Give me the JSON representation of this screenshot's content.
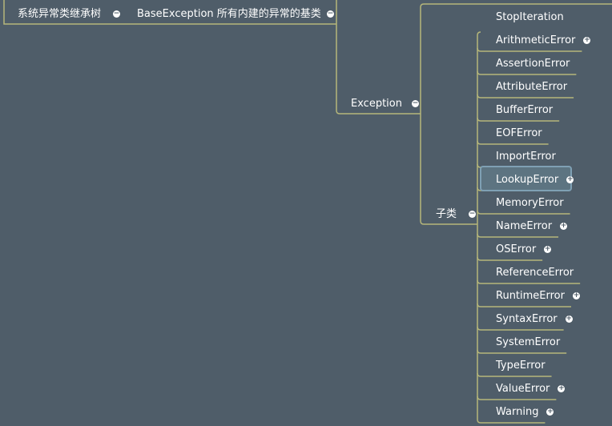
{
  "root": {
    "label": "系统异常类继承树"
  },
  "base": {
    "label": "BaseException 所有内建的异常的基类"
  },
  "exception": {
    "label": "Exception"
  },
  "subclass": {
    "label": "子类"
  },
  "stop_iteration": {
    "label": "StopIteration"
  },
  "selected": "LookupError",
  "children": [
    {
      "label": "ArithmeticError",
      "expandable": true
    },
    {
      "label": "AssertionError",
      "expandable": false
    },
    {
      "label": "AttributeError",
      "expandable": false
    },
    {
      "label": "BufferError",
      "expandable": false
    },
    {
      "label": "EOFError",
      "expandable": false
    },
    {
      "label": "ImportError",
      "expandable": false
    },
    {
      "label": "LookupError",
      "expandable": true
    },
    {
      "label": "MemoryError",
      "expandable": false
    },
    {
      "label": "NameError",
      "expandable": true
    },
    {
      "label": "OSError",
      "expandable": true
    },
    {
      "label": "ReferenceError",
      "expandable": false
    },
    {
      "label": "RuntimeError",
      "expandable": true
    },
    {
      "label": "SyntaxError",
      "expandable": true
    },
    {
      "label": "SystemError",
      "expandable": false
    },
    {
      "label": "TypeError",
      "expandable": false
    },
    {
      "label": "ValueError",
      "expandable": true
    },
    {
      "label": "Warning",
      "expandable": true
    }
  ],
  "colors": {
    "background": "#4f5d69",
    "line": "#b5b67a",
    "text": "#ffffff",
    "selected": "#7fa0b4"
  },
  "icons": {
    "collapse": "minus-circle-icon",
    "expand": "plus-circle-icon"
  }
}
